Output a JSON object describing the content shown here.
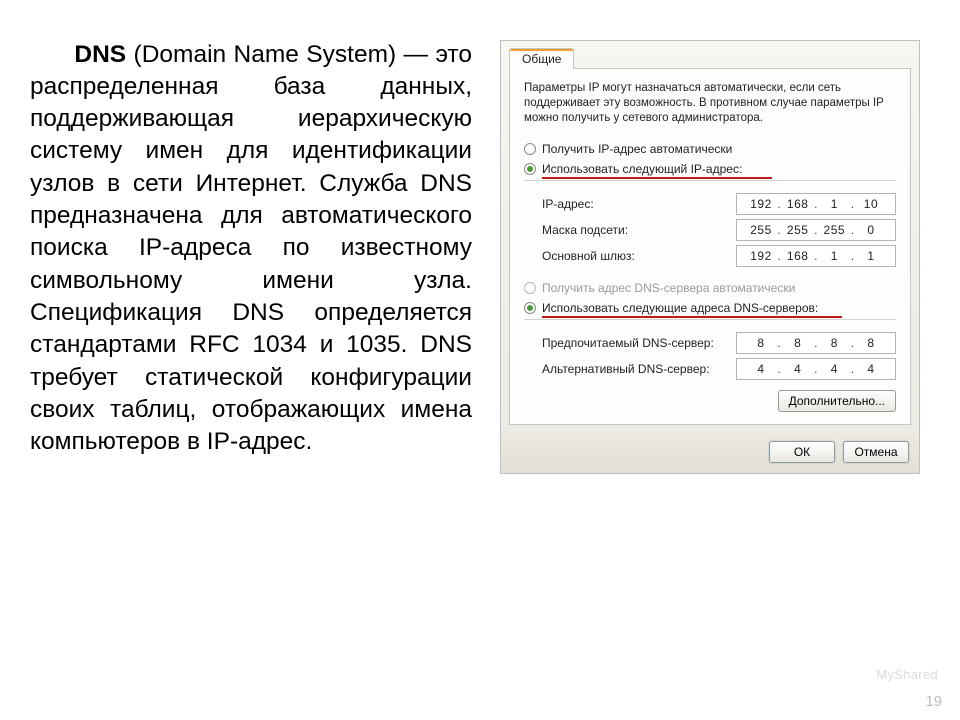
{
  "slide": {
    "lead": "DNS",
    "lead_tail": " (Domain Name System) — это распределенная база данных, поддерживающая иерархическую систему имен для идентификации узлов в сети Интернет. Служба DNS предназначена для автоматического поиска IP-адреса по известному символьному имени узла. Спецификация DNS определяется стандартами RFC 1034 и 1035. DNS требует статической конфигурации своих таблиц, отображающих имена компьютеров в IP-адрес.",
    "page_number": "19",
    "watermark": "MyShared"
  },
  "dialog": {
    "tab": "Общие",
    "intro": "Параметры IP могут назначаться автоматически, если сеть поддерживает эту возможность. В противном случае параметры IP можно получить у сетевого администратора.",
    "radio_auto_ip": "Получить IP-адрес автоматически",
    "radio_use_ip": "Использовать следующий IP-адрес:",
    "ip_label": "IP-адрес:",
    "mask_label": "Маска подсети:",
    "gateway_label": "Основной шлюз:",
    "ip_value": {
      "a": "192",
      "b": "168",
      "c": "1",
      "d": "10"
    },
    "mask_value": {
      "a": "255",
      "b": "255",
      "c": "255",
      "d": "0"
    },
    "gw_value": {
      "a": "192",
      "b": "168",
      "c": "1",
      "d": "1"
    },
    "radio_auto_dns": "Получить адрес DNS-сервера автоматически",
    "radio_use_dns": "Использовать следующие адреса DNS-серверов:",
    "pref_dns_label": "Предпочитаемый DNS-сервер:",
    "alt_dns_label": "Альтернативный DNS-сервер:",
    "pref_dns_value": {
      "a": "8",
      "b": "8",
      "c": "8",
      "d": "8"
    },
    "alt_dns_value": {
      "a": "4",
      "b": "4",
      "c": "4",
      "d": "4"
    },
    "advanced_btn": "Дополнительно...",
    "ok_btn": "ОК",
    "cancel_btn": "Отмена"
  }
}
